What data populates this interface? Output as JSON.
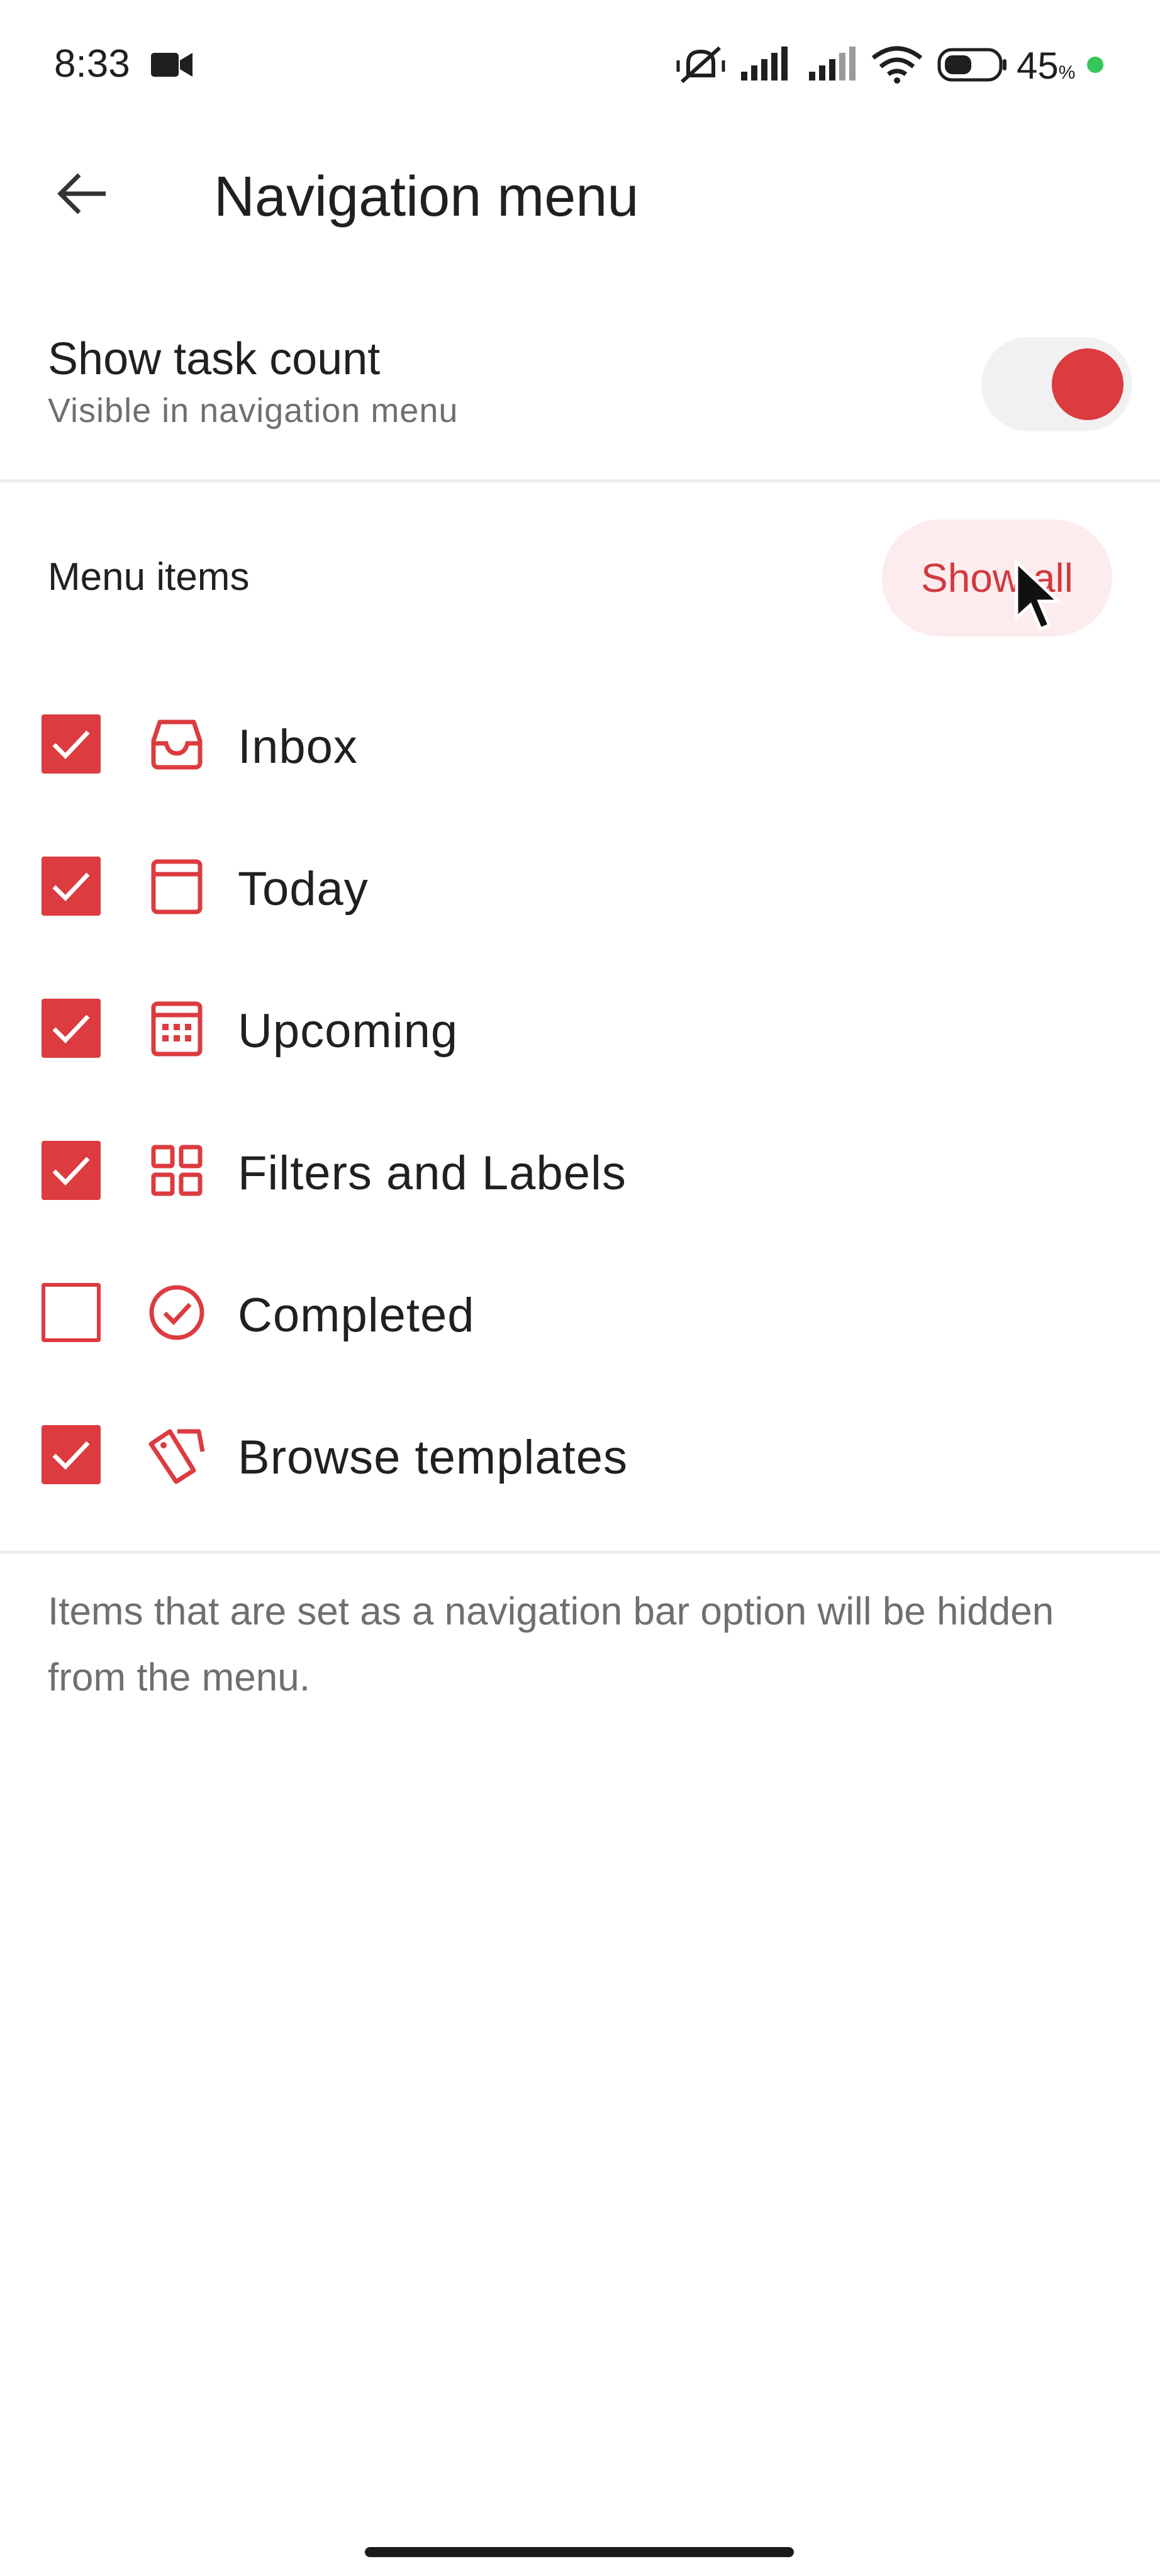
{
  "status_bar": {
    "time": "8:33",
    "battery_percent": "45",
    "battery_unit": "%",
    "icons": [
      "video-camera-icon",
      "mute-vibrate-icon",
      "signal-icon",
      "signal-icon",
      "wifi-icon",
      "battery-icon",
      "charging-dot-icon"
    ]
  },
  "header": {
    "title": "Navigation menu",
    "back_icon": "arrow-left-icon"
  },
  "task_count": {
    "title": "Show task count",
    "subtitle": "Visible in navigation menu",
    "enabled": true
  },
  "menu": {
    "header": "Menu items",
    "show_all_label": "Show all",
    "items": [
      {
        "label": "Inbox",
        "checked": true,
        "icon": "inbox-icon"
      },
      {
        "label": "Today",
        "checked": true,
        "icon": "today-icon"
      },
      {
        "label": "Upcoming",
        "checked": true,
        "icon": "calendar-icon"
      },
      {
        "label": "Filters and Labels",
        "checked": true,
        "icon": "filters-grid-icon"
      },
      {
        "label": "Completed",
        "checked": false,
        "icon": "check-circle-icon"
      },
      {
        "label": "Browse templates",
        "checked": true,
        "icon": "templates-icon"
      }
    ]
  },
  "footnote": "Items that are set as a navigation bar option will be hidden from the menu.",
  "colors": {
    "accent": "#dc3b3f",
    "accent_soft": "#fdeced",
    "text_primary": "#202020",
    "text_secondary": "#6f6f6f"
  }
}
